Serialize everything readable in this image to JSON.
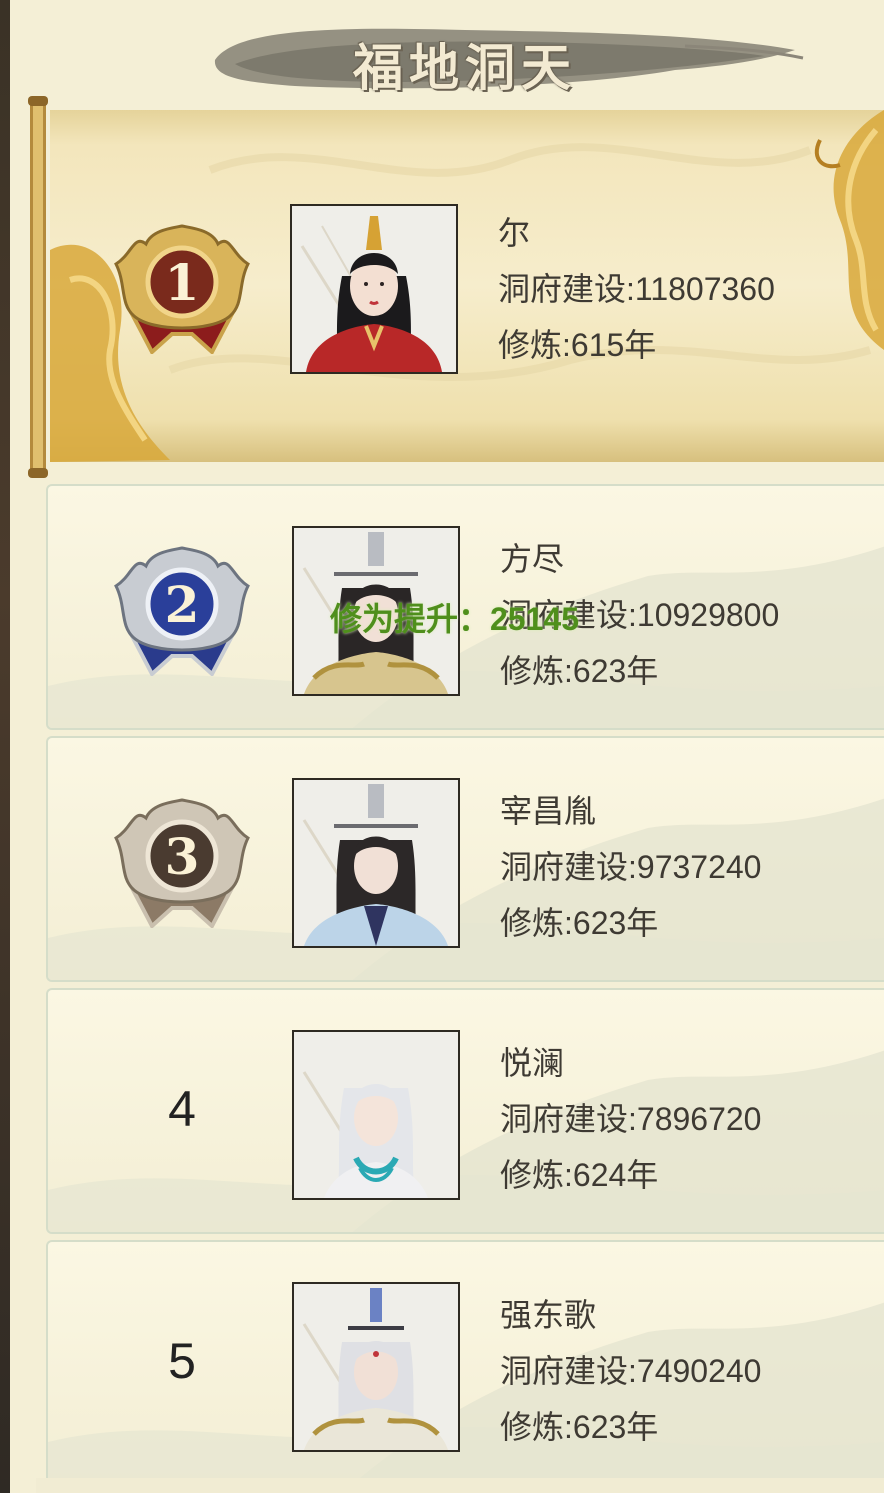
{
  "title": "福地洞天",
  "float_text": "修为提升：25145",
  "ranking": [
    {
      "rank": "1",
      "name": "尔",
      "build": "洞府建设:11807360",
      "cultivation": "修炼:615年",
      "avatar": "portrait-woman-red-robe"
    },
    {
      "rank": "2",
      "name": "方尽",
      "build": "洞府建设:10929800",
      "cultivation": "修炼:623年",
      "avatar": "portrait-man-gold-robe"
    },
    {
      "rank": "3",
      "name": "宰昌胤",
      "build": "洞府建设:9737240",
      "cultivation": "修炼:623年",
      "avatar": "portrait-man-blue-robe"
    },
    {
      "rank": "4",
      "name": "悦澜",
      "build": "洞府建设:7896720",
      "cultivation": "修炼:624年",
      "avatar": "portrait-woman-silver-hair"
    },
    {
      "rank": "5",
      "name": "强东歌",
      "build": "洞府建设:7490240",
      "cultivation": "修炼:623年",
      "avatar": "portrait-man-white-hair"
    }
  ],
  "colors": {
    "gold": "#c9a24a",
    "silver": "#c8ccd2",
    "bronze": "#9a8870",
    "float_green": "#4f8f1c"
  }
}
